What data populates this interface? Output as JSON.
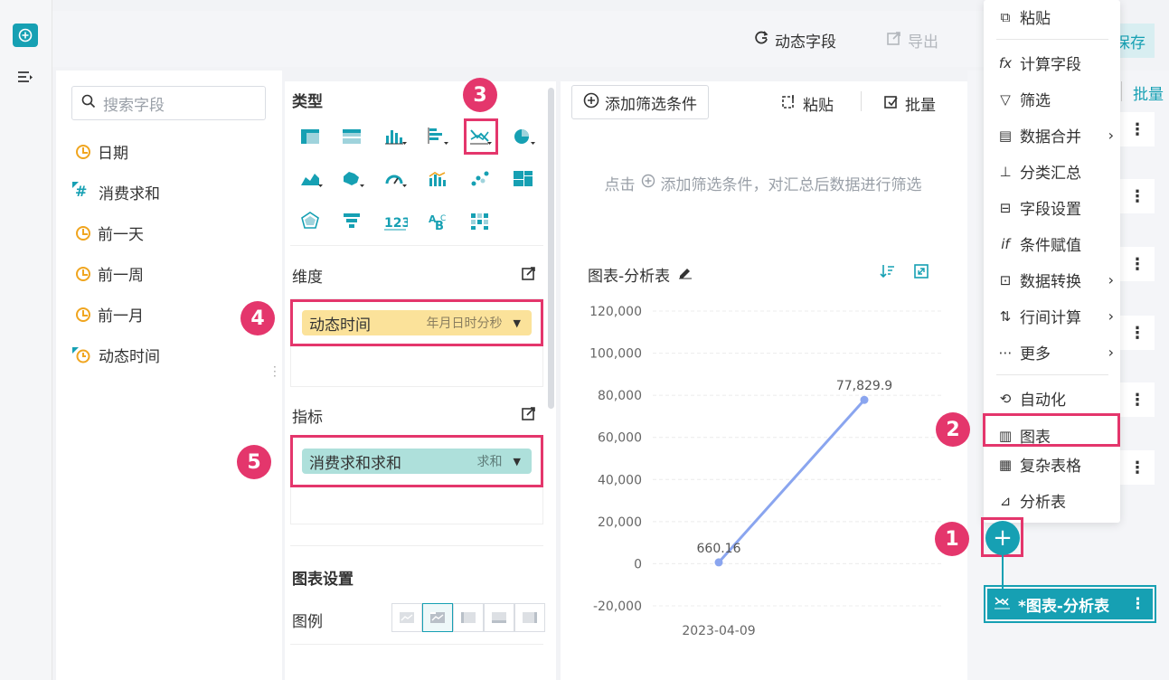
{
  "topbar": {
    "dynamic_field": "动态字段",
    "export": "导出",
    "save_partial": "保存"
  },
  "fields_panel": {
    "search_placeholder": "搜索字段",
    "fields": [
      {
        "name": "日期",
        "type": "date"
      },
      {
        "name": "消费求和",
        "type": "number-calc"
      },
      {
        "name": "前一天",
        "type": "date"
      },
      {
        "name": "前一周",
        "type": "date"
      },
      {
        "name": "前一月",
        "type": "date"
      },
      {
        "name": "动态时间",
        "type": "date-calc"
      }
    ]
  },
  "type_panel": {
    "title": "类型",
    "dimension_label": "维度",
    "dimension_pill": {
      "name": "动态时间",
      "format": "年月日时分秒"
    },
    "metric_label": "指标",
    "metric_pill": {
      "name": "消费求和求和",
      "agg": "求和"
    },
    "chart_settings": "图表设置",
    "legend_label": "图例"
  },
  "filter_area": {
    "add_filter": "添加筛选条件",
    "paste": "粘贴",
    "batch": "批量",
    "hint_prefix": "点击",
    "hint_suffix": "添加筛选条件，对汇总后数据进行筛选"
  },
  "chart": {
    "title": "图表-分析表"
  },
  "chart_data": {
    "type": "line",
    "x": [
      "2023-04-09"
    ],
    "y_ticks": [
      "120,000",
      "100,000",
      "80,000",
      "60,000",
      "40,000",
      "20,000",
      "0",
      "-20,000"
    ],
    "series": [
      {
        "values": [
          660.16,
          77829.9
        ]
      }
    ],
    "point_labels": [
      "660.16",
      "77,829.9"
    ],
    "ylim": [
      -20000,
      120000
    ],
    "grid": true,
    "color": "#8aa5ef"
  },
  "menu": {
    "items": [
      {
        "label": "粘贴",
        "icon": "paste-icon",
        "arrow": false
      },
      {
        "label": "计算字段",
        "icon": "fx-icon",
        "arrow": false
      },
      {
        "label": "筛选",
        "icon": "filter-icon",
        "arrow": false
      },
      {
        "label": "数据合并",
        "icon": "merge-icon",
        "arrow": true
      },
      {
        "label": "分类汇总",
        "icon": "group-icon",
        "arrow": false
      },
      {
        "label": "字段设置",
        "icon": "field-settings-icon",
        "arrow": false
      },
      {
        "label": "条件赋值",
        "icon": "if-icon",
        "arrow": false
      },
      {
        "label": "数据转换",
        "icon": "transform-icon",
        "arrow": true
      },
      {
        "label": "行间计算",
        "icon": "row-calc-icon",
        "arrow": true
      },
      {
        "label": "更多",
        "icon": "more-icon",
        "arrow": true
      },
      {
        "label": "自动化",
        "icon": "automation-icon",
        "arrow": false
      },
      {
        "label": "图表",
        "icon": "chart-icon",
        "arrow": false
      },
      {
        "label": "复杂表格",
        "icon": "complex-table-icon",
        "arrow": false
      },
      {
        "label": "分析表",
        "icon": "analysis-table-icon",
        "arrow": false
      }
    ]
  },
  "right_strip": {
    "batch": "批量"
  },
  "node": {
    "label": "*图表-分析表"
  },
  "badges": [
    "1",
    "2",
    "3",
    "4",
    "5"
  ],
  "colors": {
    "accent": "#16a0b3",
    "highlight": "#e4366c",
    "dim_pill": "#fbe29a",
    "metric_pill": "#aee0db"
  }
}
